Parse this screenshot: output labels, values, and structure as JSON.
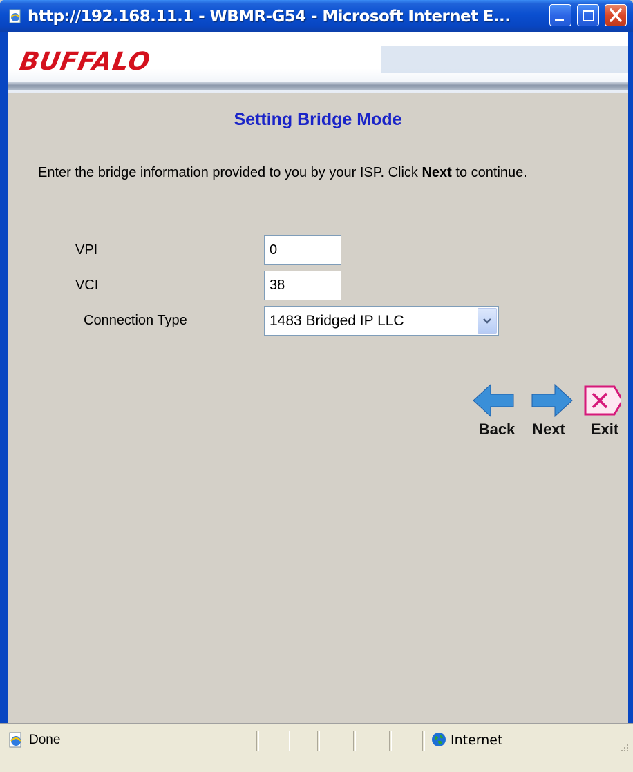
{
  "window": {
    "title": "http://192.168.11.1 - WBMR-G54 - Microsoft Internet E...",
    "controls": [
      "minimize",
      "maximize",
      "close"
    ]
  },
  "brand": {
    "logo_text": "BUFFALO",
    "logo_color": "#d4111d"
  },
  "page": {
    "title": "Setting Bridge Mode",
    "instructions_prefix": "Enter the bridge information provided to you by your ISP. Click ",
    "instructions_bold": "Next",
    "instructions_suffix": " to continue."
  },
  "form": {
    "vpi": {
      "label": "VPI",
      "value": "0"
    },
    "vci": {
      "label": "VCI",
      "value": "38"
    },
    "connection_type": {
      "label": "Connection Type",
      "selected": "1483 Bridged IP LLC"
    }
  },
  "nav": {
    "back": "Back",
    "next": "Next",
    "exit": "Exit"
  },
  "status": {
    "text": "Done",
    "zone": "Internet"
  },
  "colors": {
    "title_blue": "#1a24c8",
    "arrow_blue": "#3a8fd8",
    "exit_pink": "#d6197a",
    "xp_titlebar": "#0a4fd0"
  },
  "icons": [
    "ie-page-icon",
    "minimize-icon",
    "maximize-icon",
    "close-icon",
    "back-arrow-icon",
    "next-arrow-icon",
    "exit-icon",
    "globe-icon"
  ]
}
